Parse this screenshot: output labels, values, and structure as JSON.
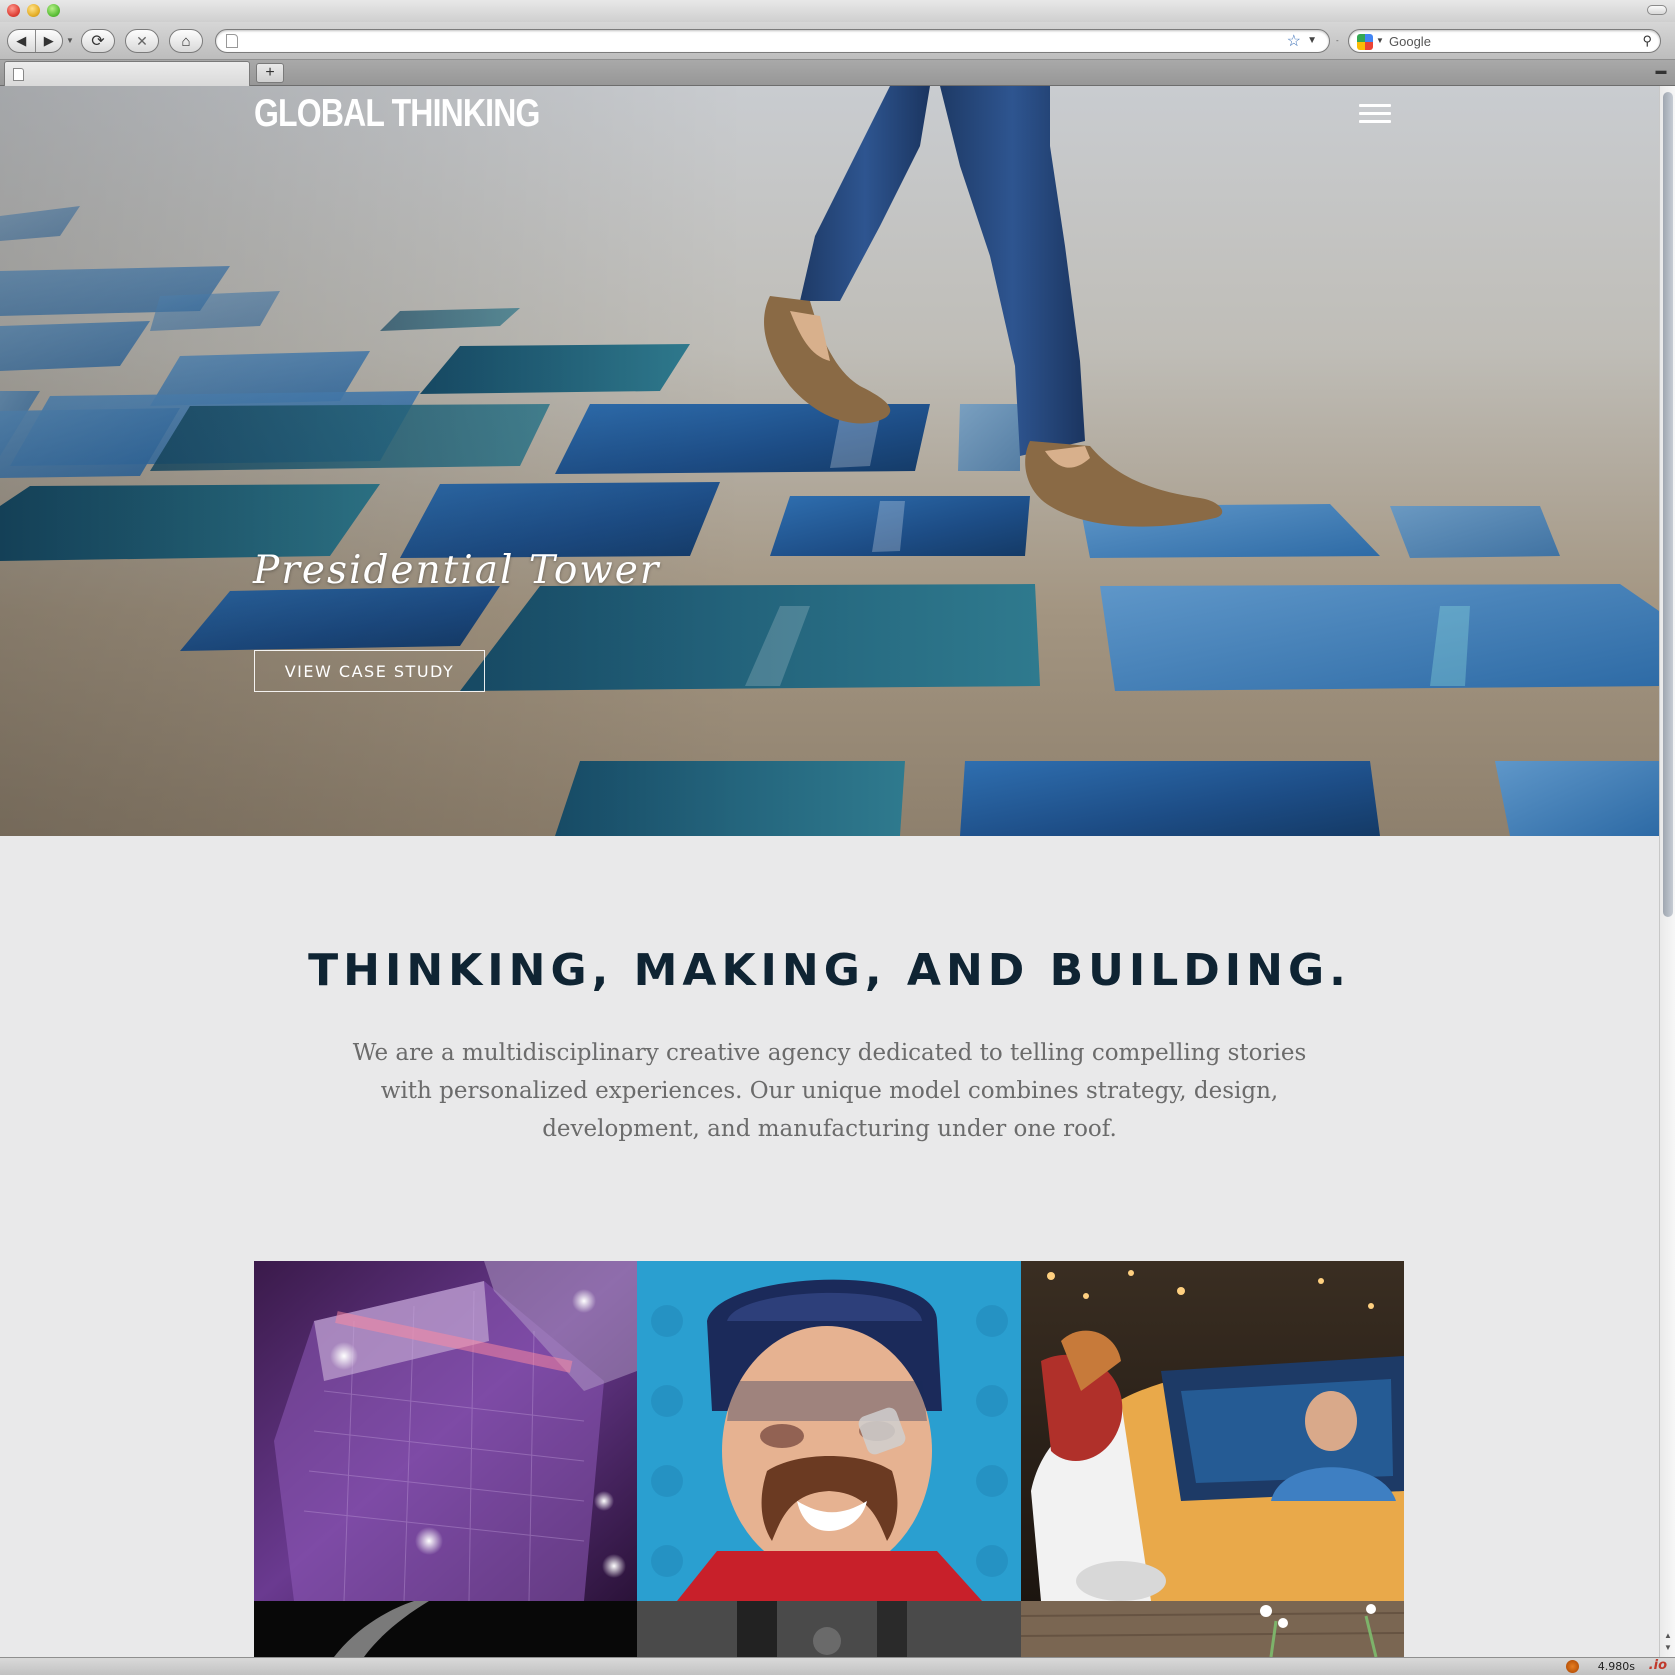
{
  "browser": {
    "url": "",
    "search_placeholder": "Google",
    "tab_title": "",
    "new_tab_label": "+",
    "status_time": "4.980s",
    "status_badge": ".io"
  },
  "site": {
    "brand": "GLOBAL THINKING",
    "menu_icon": "hamburger-icon"
  },
  "hero": {
    "title": "Presidential Tower",
    "cta_label": "VIEW CASE STUDY"
  },
  "intro": {
    "heading": "THINKING, MAKING, AND BUILDING.",
    "body": "We are a multidisciplinary creative agency dedicated to telling compelling stories with personalized experiences. Our unique model combines strategy, design, development, and manufacturing under one roof."
  },
  "colors": {
    "heading": "#0f2433",
    "body_text": "#6b6b6b",
    "page_bg": "#e9e9ea",
    "hero_tile_blue": "#1f5a96"
  }
}
